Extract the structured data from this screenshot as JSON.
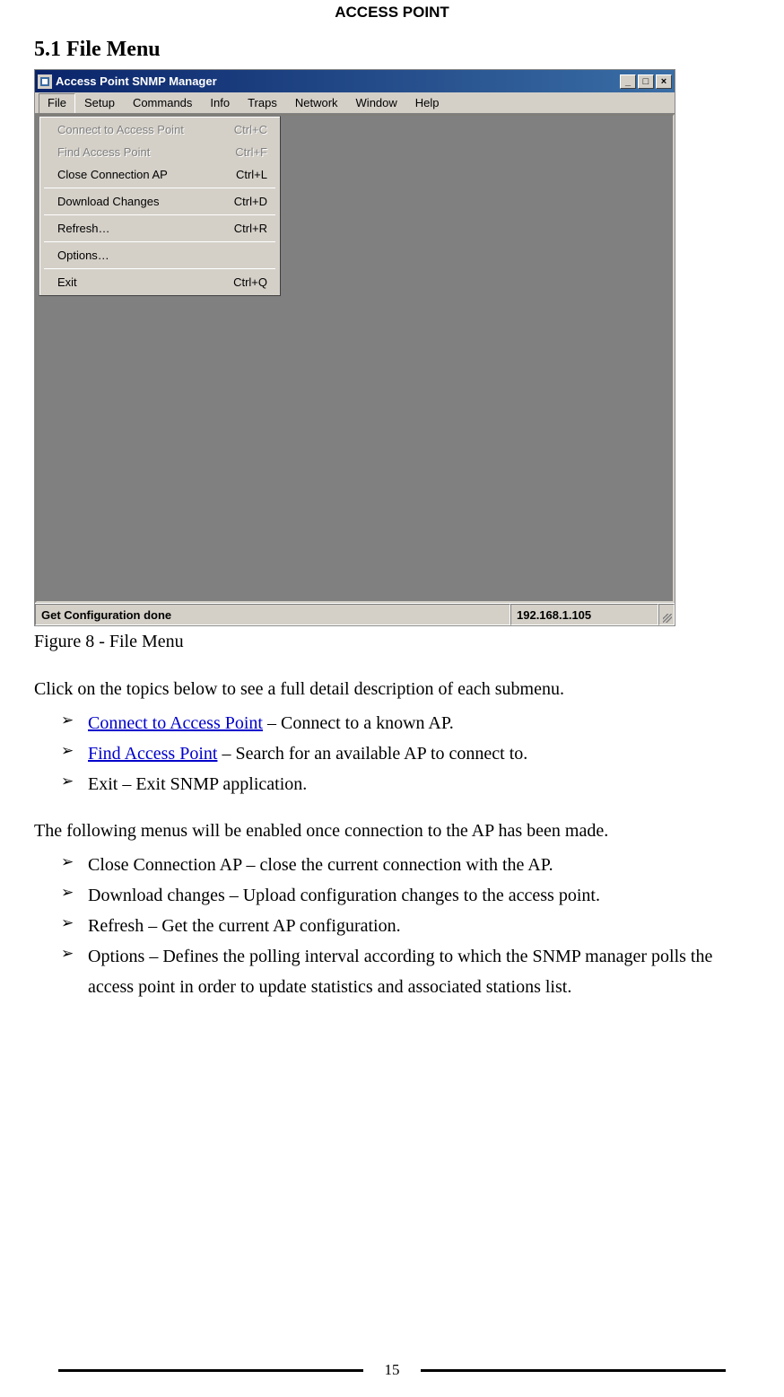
{
  "header": {
    "title": "ACCESS POINT"
  },
  "section": {
    "heading": "5.1 File Menu"
  },
  "window": {
    "title": "Access Point SNMP Manager",
    "minimize_icon": "_",
    "maximize_icon": "□",
    "close_icon": "×",
    "menubar": [
      "File",
      "Setup",
      "Commands",
      "Info",
      "Traps",
      "Network",
      "Window",
      "Help"
    ],
    "file_menu": [
      {
        "label": "Connect to Access Point",
        "accel": "Ctrl+C",
        "disabled": true
      },
      {
        "label": "Find Access Point",
        "accel": "Ctrl+F",
        "disabled": true
      },
      {
        "label": "Close Connection AP",
        "accel": "Ctrl+L",
        "disabled": false
      },
      {
        "_sep": true
      },
      {
        "label": "Download Changes",
        "accel": "Ctrl+D",
        "disabled": false
      },
      {
        "_sep": true
      },
      {
        "label": "Refresh…",
        "accel": "Ctrl+R",
        "disabled": false
      },
      {
        "_sep": true
      },
      {
        "label": "Options…",
        "accel": "",
        "disabled": false
      },
      {
        "_sep": true
      },
      {
        "label": "Exit",
        "accel": "Ctrl+Q",
        "disabled": false
      }
    ],
    "status_left": "Get Configuration done",
    "status_right": "192.168.1.105"
  },
  "figure_caption": "Figure 8 - File Menu",
  "para1": "Click on the topics below to see a full detail description of each submenu.",
  "list1": {
    "i0_link": "Connect to Access Point",
    "i0_rest": " – Connect to a known AP.",
    "i1_link": "Find Access Point",
    "i1_rest": " – Search for an available AP to connect to.",
    "i2": "Exit – Exit SNMP application."
  },
  "para2": "The following menus will be enabled once connection to the AP has been made.",
  "list2": {
    "i0": "Close Connection AP – close the current connection with the AP.",
    "i1": "Download changes – Upload configuration changes to the access point.",
    "i2": "Refresh – Get the current AP configuration.",
    "i3": "Options – Defines the polling interval according to which the SNMP manager polls the access point in order to update statistics and associated stations list."
  },
  "page_number": "15"
}
